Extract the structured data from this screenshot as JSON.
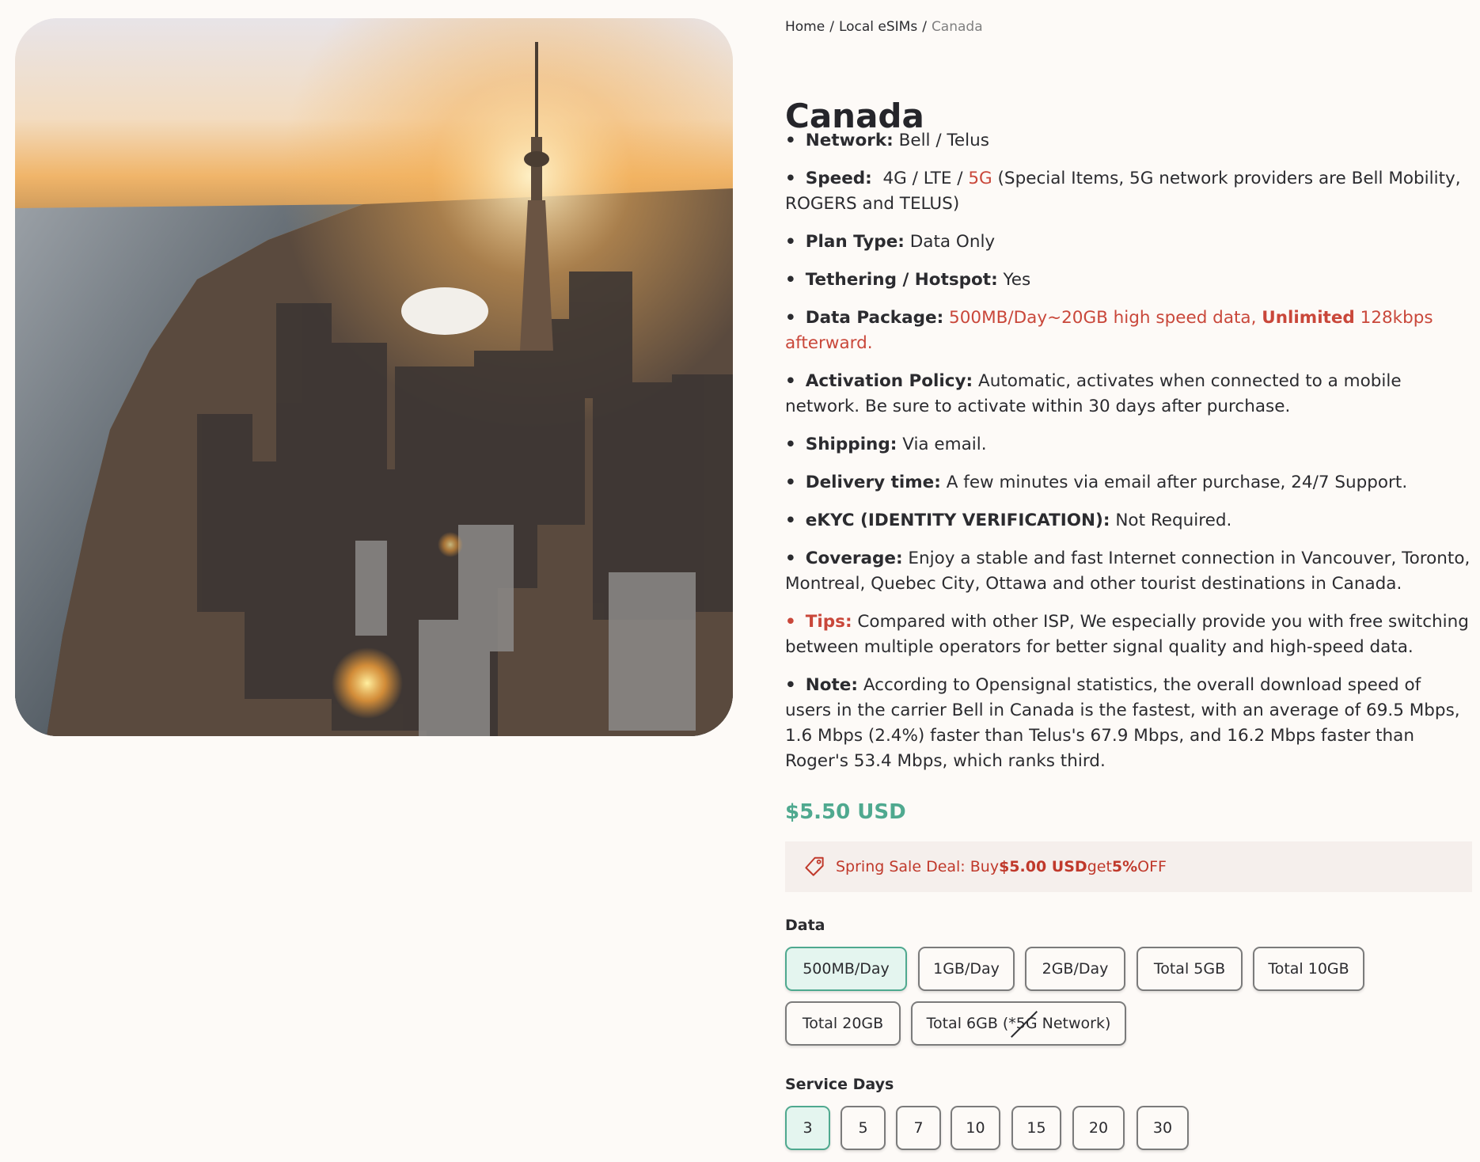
{
  "breadcrumb": {
    "home": "Home",
    "local": "Local eSIMs",
    "current": "Canada"
  },
  "product": {
    "title": "Canada"
  },
  "features": {
    "network": {
      "label": "Network:",
      "value": "Bell / Telus"
    },
    "speed": {
      "label": "Speed:",
      "value_a": "4G / LTE / ",
      "value_5g": "5G",
      "value_b": " (Special Items, 5G network providers are Bell Mobility, ROGERS and TELUS)"
    },
    "plan": {
      "label": "Plan Type:",
      "value": "Data Only"
    },
    "tethering": {
      "label": "Tethering / Hotspot:",
      "value": "Yes"
    },
    "data_package": {
      "label": "Data Package:",
      "value_a": "500MB/Day~20GB high speed data, ",
      "value_bold": "Unlimited",
      "value_b": " 128kbps afterward."
    },
    "activation": {
      "label": "Activation Policy:",
      "value": "Automatic, activates when connected to a mobile network. Be sure to activate within 30 days after purchase."
    },
    "shipping": {
      "label": "Shipping:",
      "value": "Via email."
    },
    "delivery": {
      "label": "Delivery time:",
      "value": "A few minutes via email after purchase, 24/7 Support."
    },
    "ekyc": {
      "label": "eKYC (IDENTITY VERIFICATION):",
      "value": "Not Required."
    },
    "coverage": {
      "label": "Coverage:",
      "value": "Enjoy a stable and fast Internet connection in Vancouver, Toronto, Montreal, Quebec City, Ottawa and other tourist destinations in Canada."
    },
    "tips": {
      "label": "Tips:",
      "value": "Compared with other ISP, We especially provide you with free switching between multiple operators for better signal quality and high-speed data."
    },
    "note": {
      "label": "Note:",
      "value": "According to Opensignal statistics, the overall download speed of users in the carrier Bell in Canada is the fastest, with an average of 69.5 Mbps, 1.6 Mbps (2.4%) faster than Telus's 67.9 Mbps, and 16.2 Mbps faster than Roger's 53.4 Mbps, which ranks third."
    }
  },
  "price": "$5.50 USD",
  "deal": {
    "prefix": "Spring Sale Deal: Buy ",
    "amount": "$5.00 USD",
    "middle": " get ",
    "percent": "5%",
    "suffix": " OFF",
    "icon": "tag-icon"
  },
  "data_options": {
    "label": "Data",
    "selected": "500MB/Day",
    "items": [
      "500MB/Day",
      "1GB/Day",
      "2GB/Day",
      "Total 5GB",
      "Total 10GB",
      "Total 20GB",
      "Total 6GB (*5G Network)"
    ]
  },
  "days_options": {
    "label": "Service Days",
    "selected": "3",
    "items": [
      "3",
      "5",
      "7",
      "10",
      "15",
      "20",
      "30"
    ]
  },
  "colors": {
    "accent_green": "#4fa98f",
    "accent_red": "#c9473a",
    "selected_bg": "#e4f5ef"
  }
}
